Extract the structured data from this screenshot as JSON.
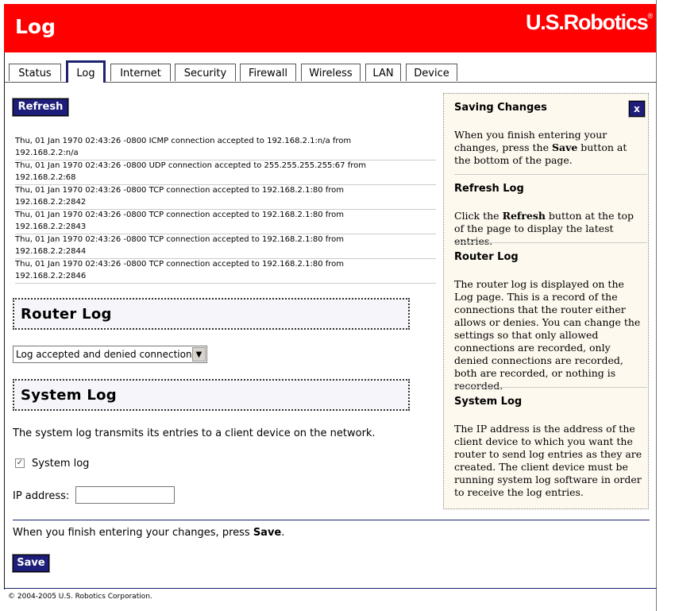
{
  "header": {
    "title": "Log",
    "logo": "U.S.Robotics",
    "logo_mark": "®"
  },
  "tabs": [
    {
      "label": "Status"
    },
    {
      "label": "Log"
    },
    {
      "label": "Internet"
    },
    {
      "label": "Security"
    },
    {
      "label": "Firewall"
    },
    {
      "label": "Wireless"
    },
    {
      "label": "LAN"
    },
    {
      "label": "Device"
    }
  ],
  "refresh_label": "Refresh",
  "log_entries": [
    {
      "line1": "Thu, 01 Jan 1970 02:43:26 -0800 ICMP connection accepted to 192.168.2.1:n/a from",
      "line2": "192.168.2.2:n/a"
    },
    {
      "line1": "Thu, 01 Jan 1970 02:43:26 -0800 UDP connection accepted to 255.255.255.255:67 from",
      "line2": "192.168.2.2:68"
    },
    {
      "line1": "Thu, 01 Jan 1970 02:43:26 -0800 TCP connection accepted to 192.168.2.1:80 from",
      "line2": "192.168.2.2:2842"
    },
    {
      "line1": "Thu, 01 Jan 1970 02:43:26 -0800 TCP connection accepted to 192.168.2.1:80 from",
      "line2": "192.168.2.2:2843"
    },
    {
      "line1": "Thu, 01 Jan 1970 02:43:26 -0800 TCP connection accepted to 192.168.2.1:80 from",
      "line2": "192.168.2.2:2844"
    },
    {
      "line1": "Thu, 01 Jan 1970 02:43:26 -0800 TCP connection accepted to 192.168.2.1:80 from",
      "line2": "192.168.2.2:2846"
    }
  ],
  "router_log": {
    "heading": "Router Log",
    "select_value": "Log accepted and denied connections"
  },
  "system_log": {
    "heading": "System Log",
    "description": "The system log transmits its entries to a client device on the network.",
    "checkbox_label": "System log",
    "checkbox_checked": true,
    "ip_label": "IP address:",
    "ip_value": ""
  },
  "save_note": {
    "prefix": "When you finish entering your changes, press ",
    "bold": "Save",
    "suffix": "."
  },
  "save_label": "Save",
  "help": {
    "close_label": "x",
    "sections": [
      {
        "title": "Saving Changes",
        "pre": "When you finish entering your changes, press the ",
        "bold": "Save",
        "post": " button at the bottom of the page."
      },
      {
        "title": "Refresh Log",
        "pre": "Click the ",
        "bold": "Refresh",
        "post": " button at the top of the page to display the latest entries."
      },
      {
        "title": "Router Log",
        "pre": "The router log is displayed on the Log page. This is a record of the connections that the router either allows or denies. You can change the settings so that only allowed connections are recorded, only denied connections are recorded, both are recorded, or nothing is recorded.",
        "bold": "",
        "post": ""
      },
      {
        "title": "System Log",
        "pre": "The IP address is the address of the client device to which you want the router to send log entries as they are created. The client device must be running system log software in order to receive the log entries.",
        "bold": "",
        "post": ""
      }
    ]
  },
  "footer": "© 2004-2005 U.S. Robotics Corporation.",
  "colors": {
    "header_red": "#ff0000",
    "button_navy": "#1e1e7a",
    "help_bg": "#fdf9ee"
  }
}
